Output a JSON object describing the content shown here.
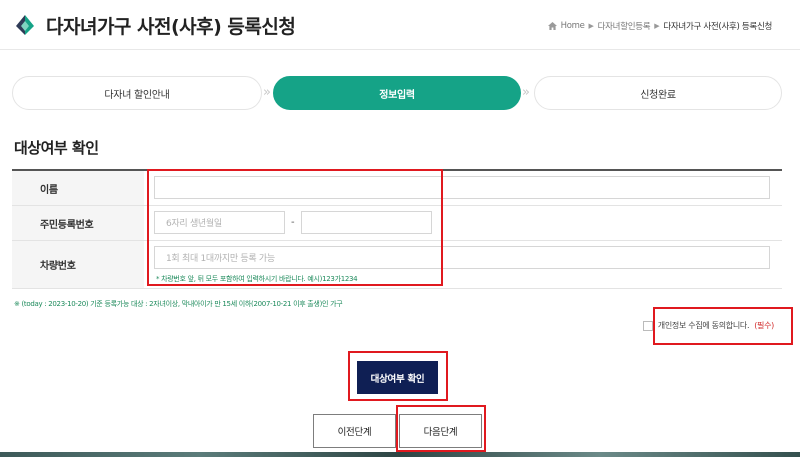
{
  "header": {
    "title": "다자녀가구 사전(사후) 등록신청",
    "breadcrumb": [
      "Home",
      "다자녀할인등록",
      "다자녀가구 사전(사후) 등록신청"
    ]
  },
  "steps": [
    {
      "label": "다자녀 할인안내",
      "active": false
    },
    {
      "label": "정보입력",
      "active": true
    },
    {
      "label": "신청완료",
      "active": false
    }
  ],
  "section_title": "대상여부 확인",
  "form": {
    "name_label": "이름",
    "name_value": "",
    "rrn_label": "주민등록번호",
    "rrn_front_placeholder": "6자리 생년월일",
    "rrn_separator": "-",
    "rrn_back_value": "",
    "car_label": "차량번호",
    "car_placeholder": "1회 최대 1대까지만 등록 가능",
    "car_hint": "* 차량번호 앞, 뒤 모두 포함하여 입력하시기 바랍니다. 예시)123가1234"
  },
  "note": "※ (today : 2023-10-20) 기준 등록가능 대상 : 2자녀이상, 막내아이가 만 15세 이하(2007-10-21 이후 출생)인 가구",
  "consent": {
    "label": "개인정보 수집에 동의합니다.",
    "required": "(필수)"
  },
  "buttons": {
    "check": "대상여부 확인",
    "prev": "이전단계",
    "next": "다음단계"
  },
  "colors": {
    "accent": "#15a387",
    "primary_button": "#0f1f54",
    "highlight": "#e0191f",
    "hint": "#1c8a5b"
  }
}
